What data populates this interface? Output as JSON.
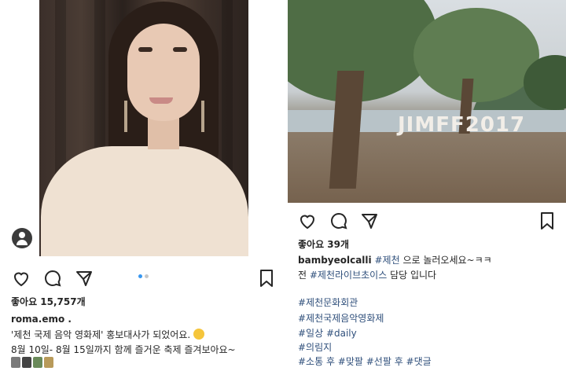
{
  "left_post": {
    "likes": "좋아요 15,757개",
    "username": "roma.emo .",
    "caption_line1": "'제천 국제 음악 영화제' 홍보대사가 되었어요.",
    "caption_line2": "8월 10일- 8월 15일까지 함께 즐거운 축제 즐겨보아요~",
    "carousel": {
      "active_index": 0,
      "count": 2
    },
    "icons": [
      "heart-icon",
      "comment-icon",
      "share-icon",
      "bookmark-icon",
      "user-tag-icon"
    ]
  },
  "right_post": {
    "photo_sign": "JIMFF2017",
    "likes": "좋아요 39개",
    "username": "bambyeolcalli",
    "caption_tag1": "#제천",
    "caption_rest1": " 으로 놀러오세요~ㅋㅋ",
    "caption_pre2": "전 ",
    "caption_tag2": "#제천라이브초이스",
    "caption_rest2": " 담당 입니다",
    "hashtags": [
      "#제천문화회관",
      "#제천국제음악영화제",
      "#일상 #daily",
      "#의림지",
      "#소통 후 #맞팔 #선팔 후 #댓글"
    ],
    "icons": [
      "heart-icon",
      "comment-icon",
      "share-icon",
      "bookmark-icon"
    ]
  },
  "colors": {
    "hashtag": "#2f4f7b",
    "dot_active": "#3897f0",
    "dot_inactive": "#c7c7c7"
  }
}
